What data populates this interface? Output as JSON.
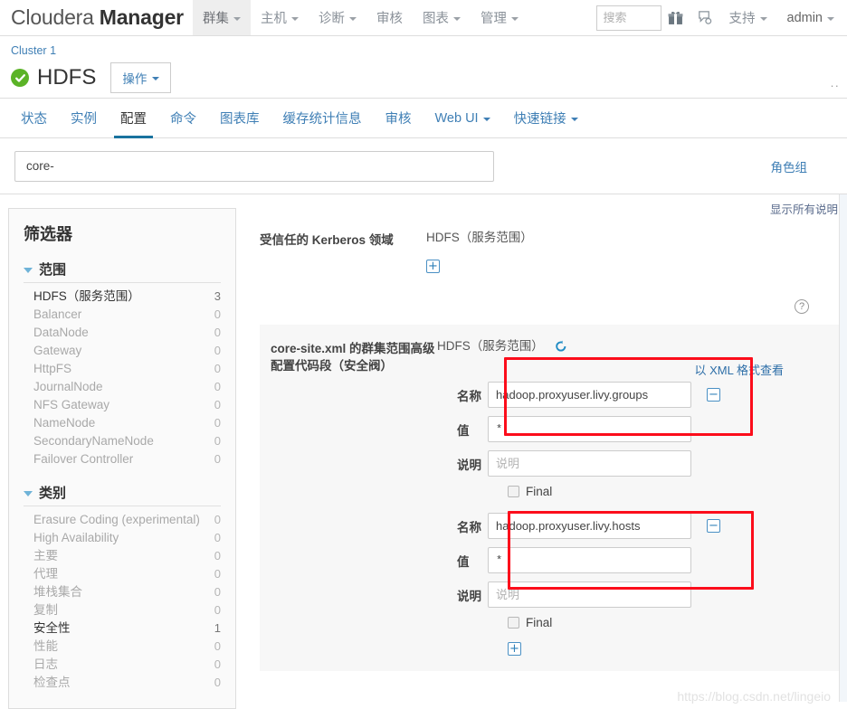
{
  "topnav": {
    "brand_light": "Cloudera",
    "brand_bold": "Manager",
    "items": [
      {
        "label": "群集",
        "has_caret": true,
        "active": true
      },
      {
        "label": "主机",
        "has_caret": true,
        "active": false
      },
      {
        "label": "诊断",
        "has_caret": true,
        "active": false
      },
      {
        "label": "审核",
        "has_caret": false,
        "active": false
      },
      {
        "label": "图表",
        "has_caret": true,
        "active": false
      },
      {
        "label": "管理",
        "has_caret": true,
        "active": false
      }
    ],
    "search_placeholder": "搜索",
    "search_value": "",
    "gift_icon": "gift-icon",
    "support_widget_icon": "support-widget-icon",
    "support_label": "支持",
    "user_label": "admin"
  },
  "service_header": {
    "breadcrumb": "Cluster 1",
    "status_icon": "green-check-circle-icon",
    "title": "HDFS",
    "actions_label": "操作",
    "ellipsis": "··"
  },
  "tabs": [
    {
      "label": "状态",
      "active": false,
      "caret": false
    },
    {
      "label": "实例",
      "active": false,
      "caret": false
    },
    {
      "label": "配置",
      "active": true,
      "caret": false
    },
    {
      "label": "命令",
      "active": false,
      "caret": false
    },
    {
      "label": "图表库",
      "active": false,
      "caret": false
    },
    {
      "label": "缓存统计信息",
      "active": false,
      "caret": false
    },
    {
      "label": "审核",
      "active": false,
      "caret": false
    },
    {
      "label": "Web UI",
      "active": false,
      "caret": true
    },
    {
      "label": "快速链接",
      "active": false,
      "caret": true
    }
  ],
  "filterbar": {
    "search_value": "core-",
    "search_placeholder": "",
    "rolegroup_label": "角色组"
  },
  "sidebar": {
    "title": "筛选器",
    "groups": [
      {
        "name": "范围",
        "items": [
          {
            "label": "HDFS（服务范围）",
            "count": "3",
            "selected": true
          },
          {
            "label": "Balancer",
            "count": "0",
            "selected": false
          },
          {
            "label": "DataNode",
            "count": "0",
            "selected": false
          },
          {
            "label": "Gateway",
            "count": "0",
            "selected": false
          },
          {
            "label": "HttpFS",
            "count": "0",
            "selected": false
          },
          {
            "label": "JournalNode",
            "count": "0",
            "selected": false
          },
          {
            "label": "NFS Gateway",
            "count": "0",
            "selected": false
          },
          {
            "label": "NameNode",
            "count": "0",
            "selected": false
          },
          {
            "label": "SecondaryNameNode",
            "count": "0",
            "selected": false
          },
          {
            "label": "Failover Controller",
            "count": "0",
            "selected": false
          }
        ]
      },
      {
        "name": "类别",
        "items": [
          {
            "label": "Erasure Coding (experimental)",
            "count": "0",
            "selected": false
          },
          {
            "label": "High Availability",
            "count": "0",
            "selected": false
          },
          {
            "label": "主要",
            "count": "0",
            "selected": false
          },
          {
            "label": "代理",
            "count": "0",
            "selected": false
          },
          {
            "label": "堆栈集合",
            "count": "0",
            "selected": false
          },
          {
            "label": "复制",
            "count": "0",
            "selected": false
          },
          {
            "label": "安全性",
            "count": "1",
            "selected": true
          },
          {
            "label": "性能",
            "count": "0",
            "selected": false
          },
          {
            "label": "日志",
            "count": "0",
            "selected": false
          },
          {
            "label": "检查点",
            "count": "0",
            "selected": false
          }
        ]
      }
    ]
  },
  "main": {
    "show_all_desc": "显示所有说明",
    "blocks": [
      {
        "label": "受信任的 Kerberos 领域",
        "scope": "HDFS（服务范围）",
        "has_reset": false,
        "add_label": "+",
        "help_label": "?"
      },
      {
        "label": "core-site.xml 的群集范围高级配置代码段（安全阀）",
        "scope": "HDFS（服务范围）",
        "has_reset": true,
        "reset_icon": "reset-circular-arrow-icon",
        "xml_view_label": "以 XML 格式查看",
        "add_label": "+",
        "properties": [
          {
            "name_key": "名称",
            "name_value": "hadoop.proxyuser.livy.groups",
            "value_key": "值",
            "value_value": "*",
            "desc_key": "说明",
            "desc_value": "",
            "desc_placeholder": "说明",
            "final_label": "Final",
            "final_checked": false,
            "remove_label": "−",
            "highlighted": true
          },
          {
            "name_key": "名称",
            "name_value": "hadoop.proxyuser.livy.hosts",
            "value_key": "值",
            "value_value": "*",
            "desc_key": "说明",
            "desc_value": "",
            "desc_placeholder": "说明",
            "final_label": "Final",
            "final_checked": false,
            "remove_label": "−",
            "highlighted": true
          }
        ]
      }
    ]
  },
  "watermark": "https://blog.csdn.net/lingeio",
  "colors": {
    "link": "#3f7fb5",
    "active_tab_underline": "#19729e",
    "status_green": "#5bb327",
    "annotation_red": "#fc0d1b",
    "shaded_panel": "#f7f7f7"
  }
}
